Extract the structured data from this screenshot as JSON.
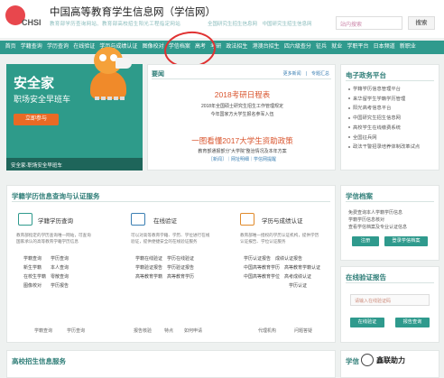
{
  "header": {
    "logo": "CHSI",
    "title": "中国高等教育学生信息网（学信网）",
    "subtitle": "教育部学历查询网站、教育部高校招生阳光工程指定网站",
    "announcement": "全国研究生招生信息网　中国研究生招生信息网",
    "search_placeholder": "站内搜索",
    "search_button": "搜索"
  },
  "nav": {
    "items": [
      "首页",
      "学籍查询",
      "学历查询",
      "在线验证",
      "学历与成绩认证",
      "图像校对",
      "学信档案",
      "高考",
      "考研",
      "政法招生",
      "港澳台招生",
      "四六级查分",
      "征兵",
      "就业",
      "学职平台",
      "日本频道",
      "新职业"
    ]
  },
  "banner": {
    "title": "安全家",
    "subtitle": "职场安全早班车",
    "button": "立即参与",
    "caption": "安全家-职场安全早班车"
  },
  "news": {
    "heading": "要闻",
    "more": "更多新闻",
    "feature": "专题汇总",
    "headline1": "2018考研日程表",
    "line1": "2018年全国硕士研究生招生工作管理规定",
    "line2": "今年国家方大学生报名参军入伍",
    "headline2": "一图看懂2017大学生资助政策",
    "line3": "教育部通报部分“大学院”整治情况及本年方案",
    "links": "［新闻］｜网址明细｜学信网提醒"
  },
  "gov": {
    "title": "电子政务平台",
    "items": [
      "学籍学历信息管理平台",
      "来华留学生学籍学历管理",
      "阳光高考信息平台",
      "中国研究生招生信息网",
      "高校学生在线缴费系统",
      "全国征兵网",
      "政法干警招录培养体制改革试点"
    ]
  },
  "query": {
    "title": "学籍学历信息查询与认证服务",
    "col1": {
      "title": "学籍学历查询",
      "desc": [
        "教育部指定的学历查询唯一网站，可查询",
        "国家承认的高等教育学籍学历信息"
      ],
      "links": [
        [
          "学籍查询",
          "学历查询"
        ],
        [
          "新生学籍",
          "本人查询"
        ],
        [
          "在校生学籍",
          "零散查询"
        ],
        [
          "图像校对",
          "学历报告"
        ]
      ]
    },
    "col2": {
      "title": "在线验证",
      "desc": [
        "可以对高等教育学籍、学历、学位进行在线",
        "验证，提供便捷安全的在线验证服务"
      ],
      "links": [
        [
          "学籍在线验证",
          "学历在线验证"
        ],
        [
          "学籍验证报告",
          "学历验证报告"
        ],
        [
          "高等教育学籍",
          "高等教育学历"
        ]
      ]
    },
    "col3": {
      "title": "学历与成绩认证",
      "desc": [
        "教育部唯一授权的学历认证机构，提供学历",
        "认证报告、学位认证服务"
      ],
      "links": [
        [
          "学历认证报告",
          "成绩认证报告"
        ],
        [
          "中国高等教育学历",
          "高等教育学籍认证"
        ],
        [
          "中国高等教育学位",
          "高考成绩认证"
        ],
        [
          "",
          "学历认证"
        ]
      ]
    },
    "footer": [
      "学籍查询",
      "学历查询",
      "报告核验",
      "特点",
      "如何申请",
      "代理机构",
      "问题答疑"
    ]
  },
  "archive": {
    "title": "学信档案",
    "lines": [
      "免费查询本人学籍学历信息",
      "学籍学历信息核对",
      "查看学信档案及专业认证信息"
    ],
    "register": "注册",
    "login": "登录学信档案"
  },
  "verify": {
    "title": "在线验证报告",
    "placeholder": "请输入在线验证码",
    "btn_verify": "在线验证",
    "btn_apply": "报告查询"
  },
  "bottom": {
    "left_title": "高校招生信息服务",
    "right_title": "学信"
  },
  "watermark": "鑫联助力",
  "colors": {
    "nav": "#2f9a8d",
    "accent_red": "#d9552e",
    "banner": "#2e9b8a",
    "button_orange": "#e96a25"
  }
}
